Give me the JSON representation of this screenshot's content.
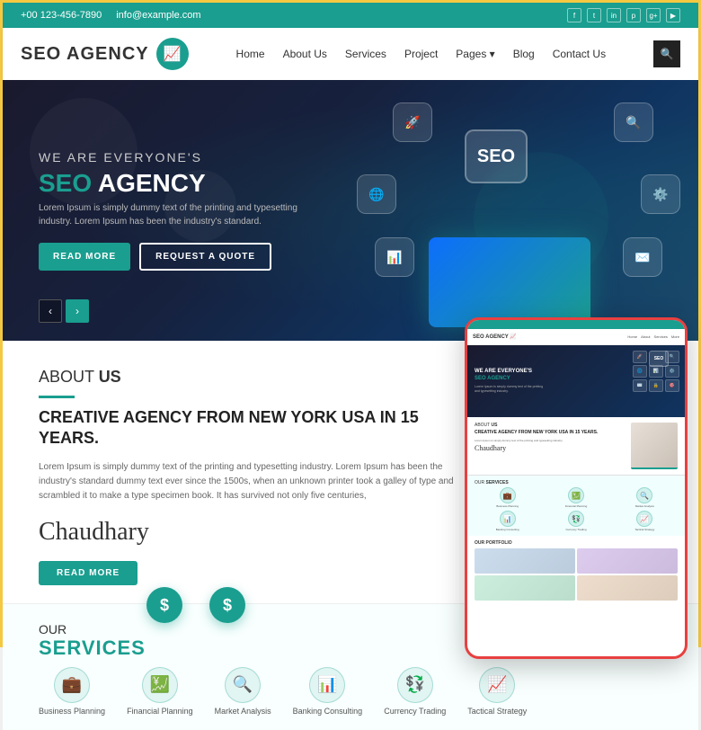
{
  "topbar": {
    "phone": "+00 123-456-7890",
    "email": "info@example.com",
    "socials": [
      "f",
      "t",
      "in",
      "p",
      "g+",
      "yt"
    ]
  },
  "navbar": {
    "logo_text": "SEO AGENCY",
    "logo_icon": "📈",
    "links": [
      "Home",
      "About Us",
      "Services",
      "Project",
      "Pages ▾",
      "Blog",
      "Contact Us"
    ]
  },
  "hero": {
    "pre_title": "WE ARE EVERYONE'S",
    "title": "SEO",
    "title_suffix": "AGENCY",
    "description": "Lorem Ipsum is simply dummy text of the printing and typesetting industry.\nLorem Ipsum has been the industry's standard.",
    "btn_read": "READ MORE",
    "btn_quote": "REQUEST A QUOTE",
    "icons": [
      "🚀",
      "🔍",
      "🌐",
      "⚙️",
      "📊",
      "✉️",
      "🔒",
      "🎯"
    ]
  },
  "about": {
    "label": "ABOUT",
    "label_strong": "US",
    "title": "CREATIVE AGENCY FROM NEW YORK USA IN 15 YEARS.",
    "description": "Lorem Ipsum is simply dummy text of the printing and typesetting industry. Lorem Ipsum has been the industry's standard dummy text ever since the 1500s, when an unknown printer took a galley of type and scrambled it to make a type specimen book. It has survived not only five centuries,",
    "btn": "READ MORE"
  },
  "services": {
    "label": "OUR",
    "label_strong": "SERVICES",
    "items": [
      {
        "icon": "💼",
        "label": "Business Planning"
      },
      {
        "icon": "💹",
        "label": "Financial Planning"
      },
      {
        "icon": "🔍",
        "label": "Market Analysis"
      },
      {
        "icon": "📊",
        "label": "Banking Consulting"
      },
      {
        "icon": "💱",
        "label": "Currency Trading"
      },
      {
        "icon": "📈",
        "label": "Tactical Strategy"
      }
    ]
  },
  "mini_tablet": {
    "visible": true,
    "portfolio_label": "OUR PORTFOLIO"
  }
}
